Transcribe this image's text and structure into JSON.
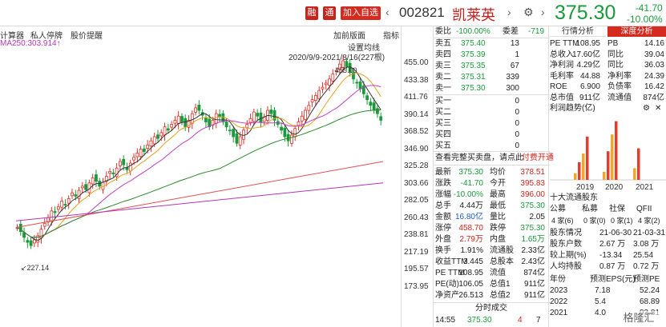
{
  "header": {
    "badges": [
      "融",
      "通"
    ],
    "add_watch": "加入自选",
    "code": "002821",
    "name": "凯莱英",
    "price": "375.30",
    "change": "-41.70",
    "change_pct": "-10.00%"
  },
  "chart": {
    "toolbar_left": "计算器",
    "toolbar_2": "私人停牌",
    "toolbar_3": "股价提醒",
    "toolbar_right1": "加前版面",
    "toolbar_right2": "指标",
    "ma_label": "MA250:303.914↑",
    "set_ma": "设置均线",
    "date_range": "2020/9/9-2021/8/16(227根)",
    "high_label": "455.00",
    "low_label": "227.14",
    "axis": [
      "455.00",
      "433.38",
      "411.76",
      "390.14",
      "368.52",
      "346.90",
      "325.28",
      "303.66",
      "282.05",
      "260.43",
      "238.81",
      "217.19",
      "195.57",
      "173.95"
    ]
  },
  "orderbook": {
    "weibi_label": "委比",
    "weibi": "-100.00%",
    "weicha_label": "委差",
    "weicha": "-719",
    "asks": [
      {
        "label": "卖五",
        "price": "375.40",
        "vol": "13"
      },
      {
        "label": "卖四",
        "price": "375.39",
        "vol": "1"
      },
      {
        "label": "卖三",
        "price": "375.35",
        "vol": "67"
      },
      {
        "label": "卖二",
        "price": "375.31",
        "vol": "339"
      },
      {
        "label": "卖一",
        "price": "375.30",
        "vol": "300"
      }
    ],
    "bids": [
      {
        "label": "买一",
        "vol": "0"
      },
      {
        "label": "买二",
        "vol": "0"
      },
      {
        "label": "买三",
        "vol": "0"
      },
      {
        "label": "买四",
        "vol": "0"
      },
      {
        "label": "买五",
        "vol": "0"
      }
    ],
    "notice1": "查看完整买卖盘，请点此",
    "notice2": "付费开通",
    "stats": [
      [
        "最新",
        "375.30",
        "均价",
        "378.51"
      ],
      [
        "涨跌",
        "-41.70",
        "今开",
        "395.83"
      ],
      [
        "涨幅",
        "-10.00%",
        "最高",
        "396.00"
      ],
      [
        "总手",
        "4.44万",
        "最低",
        "375.30"
      ],
      [
        "金额",
        "16.80亿",
        "量比",
        "2.05"
      ],
      [
        "涨停",
        "458.70",
        "跌停",
        "375.30"
      ],
      [
        "外盘",
        "2.79万",
        "内盘",
        "1.65万"
      ],
      [
        "换手",
        "1.91%",
        "流通股",
        "2.33亿"
      ],
      [
        "收益TTM",
        "3.445",
        "总股本",
        "2.43亿"
      ],
      [
        "PE TTM",
        "108.95",
        "流值",
        "874亿"
      ],
      [
        "PE(动)",
        "106.05",
        "总值1",
        "911亿"
      ],
      [
        "净资产",
        "26.513",
        "总值2",
        "911亿"
      ]
    ],
    "ticks_title": "分时成交",
    "tick": {
      "time": "14:55",
      "price": "375.30",
      "vol": "4",
      "n": "7"
    }
  },
  "right": {
    "tab1": "行情分析",
    "tab2": "深度分析",
    "metrics": [
      [
        "PE TTM",
        "108.95",
        "PB",
        "14.16"
      ],
      [
        "总收入",
        "17.60亿",
        "同比",
        "39.04"
      ],
      [
        "净利润",
        "4.29亿",
        "同比",
        "36.03"
      ],
      [
        "毛利率",
        "44.88",
        "净利率",
        "24.39"
      ],
      [
        "ROE",
        "6.900",
        "负债率",
        "16.42"
      ],
      [
        "总市值",
        "911亿",
        "流通值",
        "874亿"
      ]
    ],
    "trend_title": "利润趋势(亿)",
    "years": [
      "2019",
      "2020",
      "2021"
    ],
    "bars": {
      "2019": [
        0.9,
        2.4,
        3.6,
        5.9
      ],
      "2020": [
        1.1,
        3.9,
        6.2,
        8.0
      ],
      "2021": [
        1.6,
        4.3
      ]
    },
    "holders_title": "十大流通股东",
    "holders_head": [
      "公募",
      "私募",
      "社保",
      "QFII"
    ],
    "holders_vals": [
      "4 家(6)",
      "0 家(0)",
      "0 家(1)",
      "4 家(2)"
    ],
    "shareholders": [
      [
        "股东情况",
        "21-06-30",
        "21-03-31"
      ],
      [
        "股东户数",
        "2.67 万",
        "3.08 万"
      ],
      [
        "较上期(%)",
        "-13.34",
        "25.54"
      ],
      [
        "人均持股",
        "0.87 万",
        "0.72 万"
      ]
    ],
    "forecast_head": [
      "年份",
      "预测EPS(元)",
      "预测PE"
    ],
    "forecast": [
      [
        "2023",
        "7.18",
        "52.24"
      ],
      [
        "2022",
        "5.4",
        "68.89"
      ],
      [
        "2021",
        "4.0",
        "93.81"
      ]
    ],
    "watermark": "格隆汇"
  }
}
